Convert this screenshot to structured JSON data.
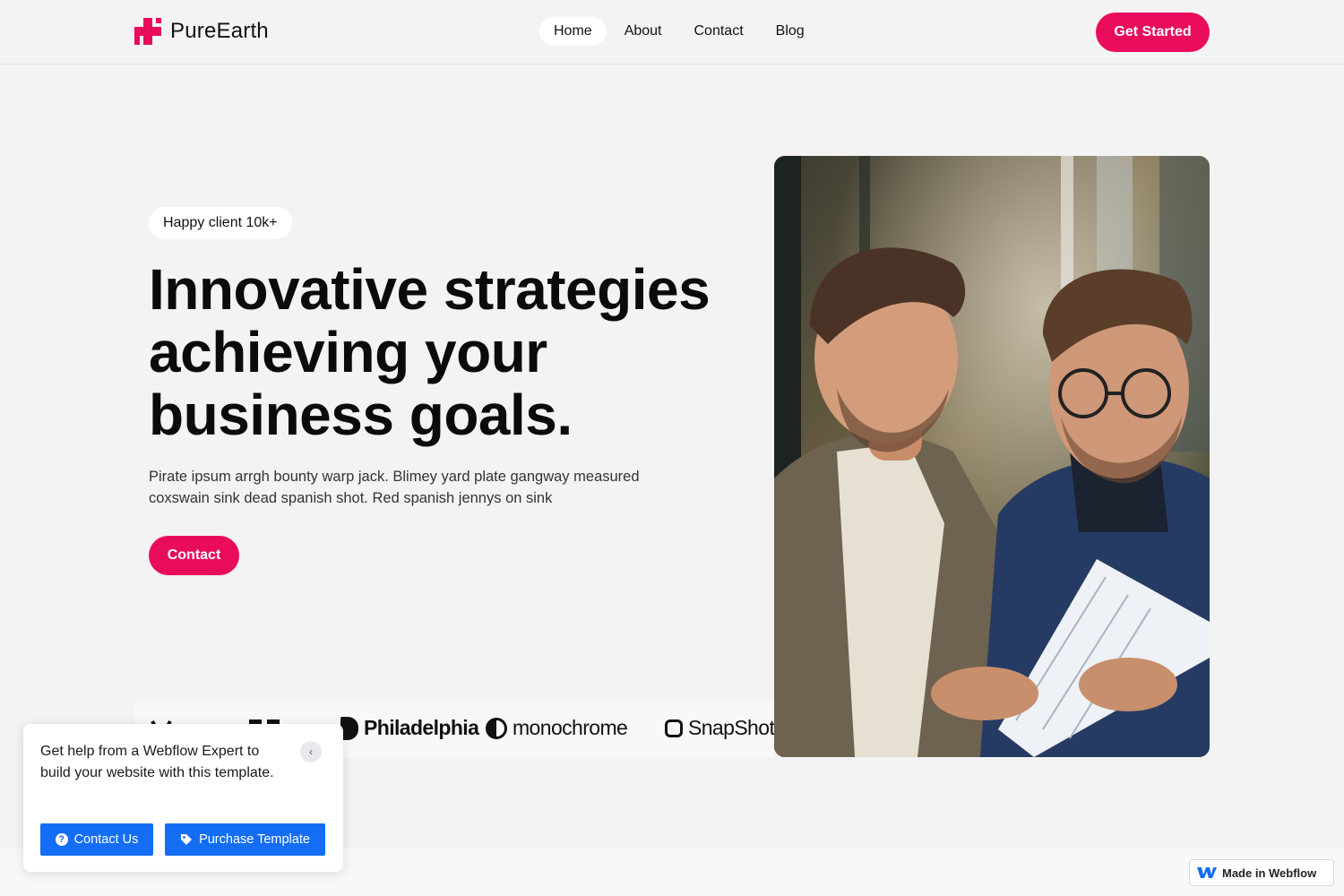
{
  "header": {
    "logo_text": "PureEarth",
    "nav": [
      {
        "label": "Home",
        "active": true
      },
      {
        "label": "About",
        "active": false
      },
      {
        "label": "Contact",
        "active": false
      },
      {
        "label": "Blog",
        "active": false
      }
    ],
    "cta_label": "Get Started"
  },
  "hero": {
    "badge": "Happy client 10k+",
    "title": "Innovative strategies achieving your business goals.",
    "description": "Pirate ipsum arrgh bounty warp jack. Blimey yard plate gangway measured coxswain sink dead spanish shot. Red spanish jennys on sink",
    "cta_label": "Contact"
  },
  "partners": [
    "Philadelphia",
    "monochrome",
    "SnapShot"
  ],
  "help_popup": {
    "text": "Get help from a Webflow Expert to build your website with this template.",
    "contact_label": "Contact Us",
    "purchase_label": "Purchase Template"
  },
  "webflow_badge": "Made in Webflow",
  "colors": {
    "accent": "#ea0c5c",
    "webflow_blue": "#146ef5",
    "background": "#f3f3f3"
  }
}
